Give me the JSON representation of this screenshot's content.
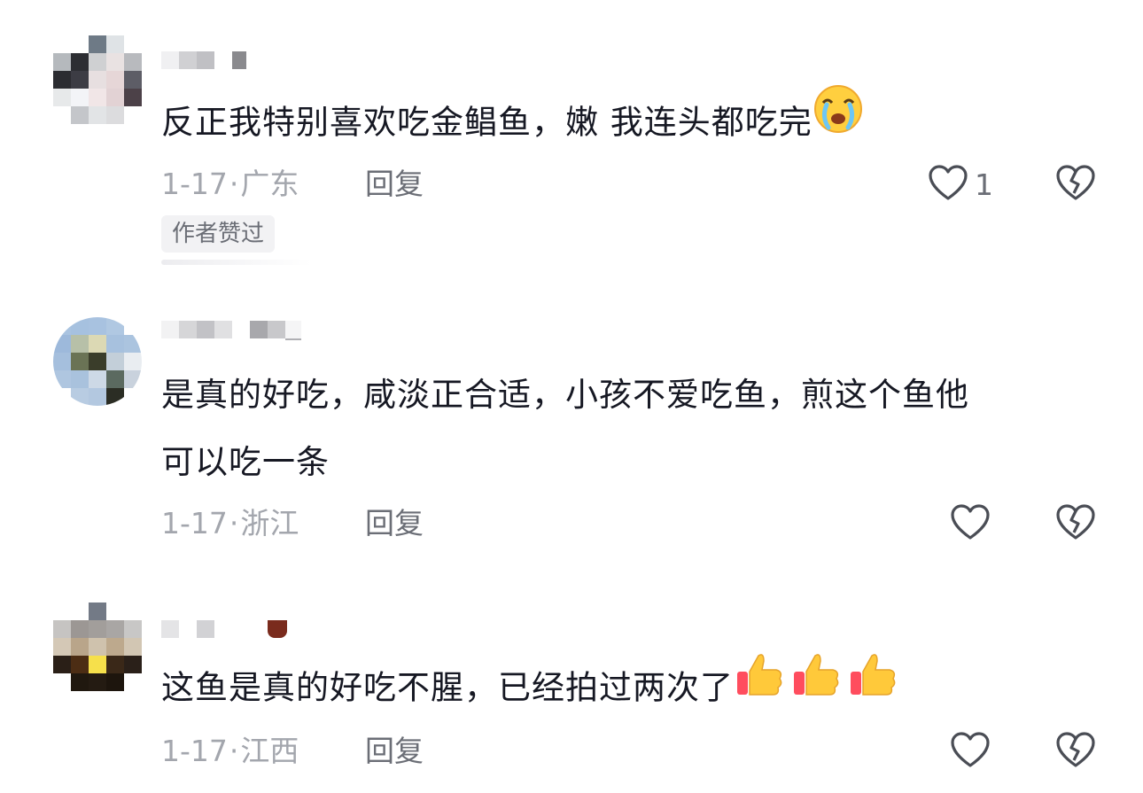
{
  "comments": [
    {
      "text": "反正我特别喜欢吃金鲳鱼，嫩 我连头都吃完",
      "emoji": "crying-face-emoji",
      "date": "1-17",
      "location": "广东",
      "reply_label": "回复",
      "like_count": "1",
      "badge": "作者赞过"
    },
    {
      "text_line1": "是真的好吃，咸淡正合适，小孩不爱吃鱼，煎这个鱼他",
      "text_line2": "可以吃一条",
      "date": "1-17",
      "location": "浙江",
      "reply_label": "回复"
    },
    {
      "text": "这鱼是真的好吃不腥，已经拍过两次了",
      "emoji": "thumbs-up-emoji",
      "date": "1-17",
      "location": "江西",
      "reply_label": "回复"
    }
  ],
  "meta_separator": "·",
  "colors": {
    "text": "#161823",
    "meta": "#a3a6ad",
    "reply": "#6b6e76",
    "badge_bg": "#f2f2f4",
    "icon_stroke": "#4a4d55"
  }
}
